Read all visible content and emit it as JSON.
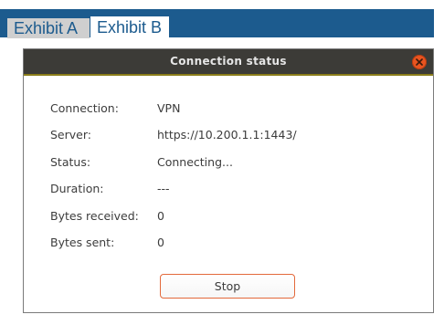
{
  "tabs": [
    {
      "label": "Exhibit A",
      "active": false
    },
    {
      "label": "Exhibit B",
      "active": true
    }
  ],
  "dialog": {
    "title": "Connection status",
    "close_icon": "close-icon",
    "fields": {
      "connection": {
        "label": "Connection:",
        "value": "VPN"
      },
      "server": {
        "label": "Server:",
        "value": "https://10.200.1.1:1443/"
      },
      "status": {
        "label": "Status:",
        "value": "Connecting..."
      },
      "duration": {
        "label": "Duration:",
        "value": "---"
      },
      "bytes_received": {
        "label": "Bytes received:",
        "value": "0"
      },
      "bytes_sent": {
        "label": "Bytes sent:",
        "value": "0"
      }
    },
    "stop_label": "Stop"
  },
  "colors": {
    "tabbar": "#1c5b8e",
    "titlebar": "#3c3b37",
    "close_button": "#e95420",
    "button_border": "#e3693b"
  }
}
